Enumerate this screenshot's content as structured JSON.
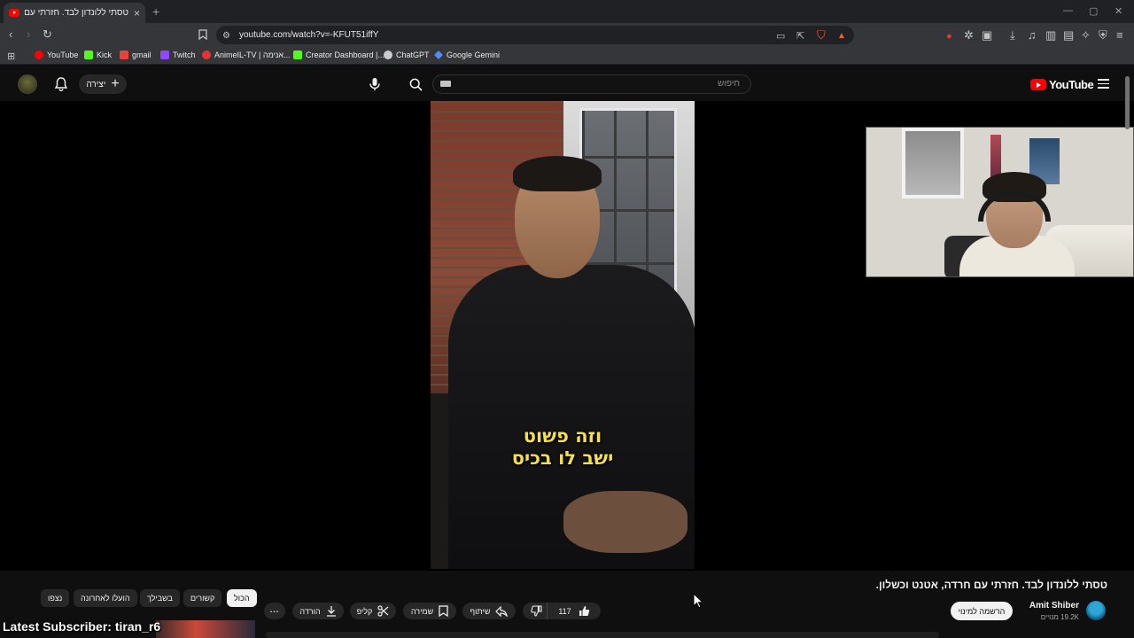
{
  "browser": {
    "tab_title": "טסתי ללונדון לבד. חזרתי עם חרדה...",
    "url": "youtube.com/watch?v=-KFUT51iffY",
    "new_tab": "+",
    "close_tab": "×",
    "window_controls": [
      "—",
      "▢",
      "✕"
    ],
    "bookmarks": [
      {
        "label": "YouTube",
        "color": "#ff0000"
      },
      {
        "label": "Kick",
        "color": "#53fc18"
      },
      {
        "label": "gmail",
        "color": "#ea4335"
      },
      {
        "label": "Twitch",
        "color": "#9146ff"
      },
      {
        "label": "AnimeIL-TV | אנימה...",
        "color": "#e3342f"
      },
      {
        "label": "Creator Dashboard |...",
        "color": "#53fc18"
      },
      {
        "label": "ChatGPT",
        "color": "#cccccc"
      },
      {
        "label": "Google Gemini",
        "color": "#4f8ef7"
      }
    ]
  },
  "masthead": {
    "logo_text": "YouTube",
    "search_placeholder": "חיפוש",
    "create_label": "יצירה"
  },
  "video": {
    "caption_line1": "וזה פשוט",
    "caption_line2": "ישב לו בכיס"
  },
  "details": {
    "title": "טסתי ללונדון לבד. חזרתי עם חרדה, אטנט וכשלון.",
    "channel_name": "Amit Shiber",
    "subscribers": "19.2K מנויים",
    "subscribe_label": "הרשמה למינוי",
    "like_count": "117",
    "share_label": "שיתוף",
    "save_label": "שמירה",
    "clip_label": "קליפ",
    "download_label": "הורדה",
    "more_label": "..."
  },
  "chips": [
    "הכול",
    "קשורים",
    "בשבילך",
    "הועלו לאחרונה",
    "נצפו"
  ],
  "stream_overlay": {
    "text": "Latest Subscriber: tiran_r6"
  },
  "colors": {
    "page_bg": "#0f0f0f",
    "caption": "#f4e04a",
    "brand_red": "#ff0000"
  }
}
